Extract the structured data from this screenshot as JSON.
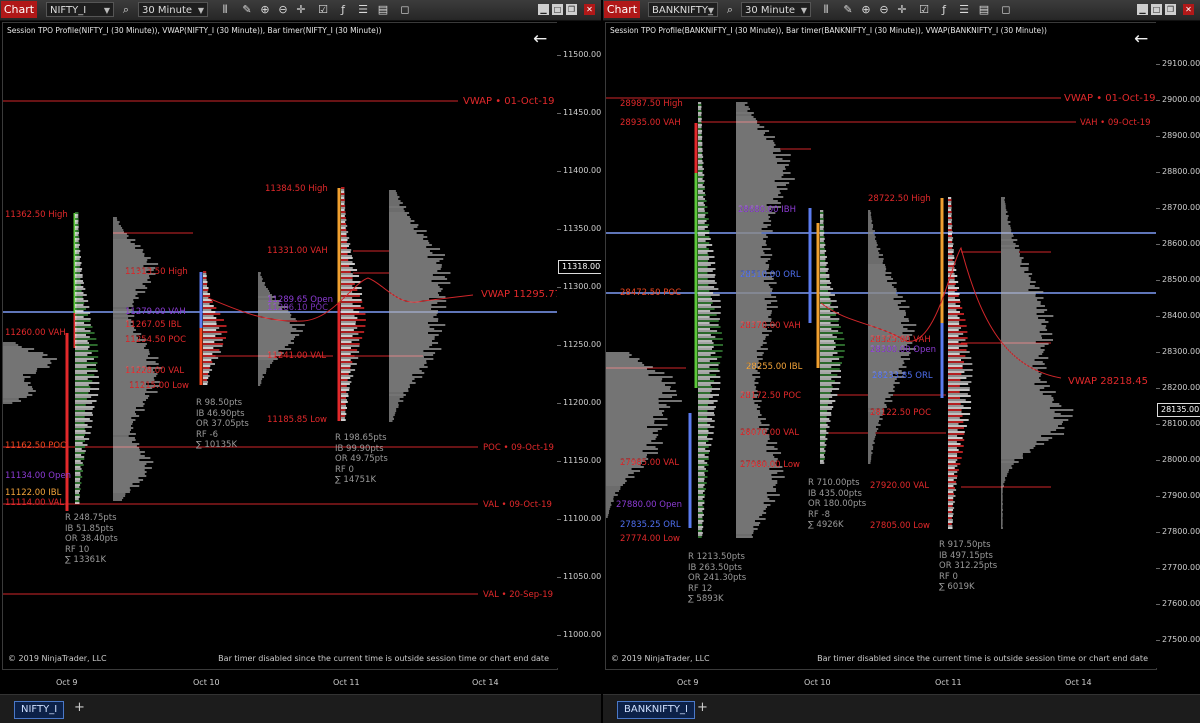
{
  "left": {
    "toolbar": {
      "chart_label": "Chart",
      "instrument": "NIFTY_I",
      "interval": "30 Minute"
    },
    "title": "Session TPO Profile(NIFTY_I (30 Minute)), VWAP(NIFTY_I (30 Minute)), Bar timer(NIFTY_I (30 Minute))",
    "f_label": "F",
    "copyright": "© 2019 NinjaTrader, LLC",
    "bar_timer": "Bar timer disabled since the current time is outside session time or chart end date",
    "y_ticks": [
      "11500.00",
      "11450.00",
      "11400.00",
      "11350.00",
      "11300.00",
      "11250.00",
      "11200.00",
      "11150.00",
      "11100.00",
      "11050.00",
      "11000.00"
    ],
    "current_price": "11318.00",
    "x_ticks": [
      "Oct 9",
      "Oct 10",
      "Oct 11",
      "Oct 14"
    ],
    "tab": "NIFTY_I",
    "labels": {
      "vwap_oct1": "VWAP • 01-Oct-19",
      "vwap_now": "VWAP 11295.77",
      "poc_oct9": "POC • 09-Oct-19",
      "val_oct9": "VAL • 09-Oct-19",
      "val_sep20": "VAL • 20-Sep-19",
      "d1_high": "11362.50 High",
      "d1_vah": "11260.00 VAH",
      "d1_poc": "11162.50 POC",
      "d1_open": "11134.00 Open",
      "d1_ibl": "11122.00 IBL",
      "d1_val": "11114.00 VAL",
      "d2_high": "11313.50 High",
      "d2_vah": "11279.00 VAH",
      "d2_ibl": "11267.05 IBL",
      "d2_poc": "11254.50 POC",
      "d2_val": "11228.00 VAL",
      "d2_low": "11215.00 Low",
      "d3_high": "11384.50 High",
      "d3_vah": "11331.00 VAH",
      "d3_open": "11289.65 Open",
      "d3_poc": "11286.10 POC",
      "d3_val": "11241.00 VAL",
      "d3_low": "11185.85 Low"
    },
    "stats": {
      "d1": [
        "R 248.75pts",
        "IB 51.85pts",
        "OR 38.40pts",
        "RF 10",
        "∑ 13361K"
      ],
      "d2": [
        "R 98.50pts",
        "IB 46.90pts",
        "OR 37.05pts",
        "RF -6",
        "∑ 10135K"
      ],
      "d3": [
        "R 198.65pts",
        "IB 99.90pts",
        "OR 49.75pts",
        "RF 0",
        "∑ 14751K"
      ]
    }
  },
  "right": {
    "toolbar": {
      "chart_label": "Chart",
      "instrument": "BANKNIFTY_",
      "interval": "30 Minute"
    },
    "title": "Session TPO Profile(BANKNIFTY_I (30 Minute)), Bar timer(BANKNIFTY_I (30 Minute)), VWAP(BANKNIFTY_I (30 Minute))",
    "f_label": "F",
    "copyright": "© 2019 NinjaTrader, LLC",
    "bar_timer": "Bar timer disabled since the current time is outside session time or chart end date",
    "y_ticks": [
      "29100.00",
      "29000.00",
      "28900.00",
      "28800.00",
      "28700.00",
      "28600.00",
      "28500.00",
      "28400.00",
      "28300.00",
      "28200.00",
      "28100.00",
      "28000.00",
      "27900.00",
      "27800.00",
      "27700.00",
      "27600.00",
      "27500.00"
    ],
    "current_price": "28135.00",
    "x_ticks": [
      "Oct 9",
      "Oct 10",
      "Oct 11",
      "Oct 14"
    ],
    "tab": "BANKNIFTY_I",
    "labels": {
      "vwap_oct1": "VWAP • 01-Oct-19",
      "vah_oct9": "VAH • 09-Oct-19",
      "vwap_now": "VWAP 28218.45",
      "d1_high": "28987.50 High",
      "d1_vah": "28935.00 VAH",
      "d1_poc": "28472.50 POC",
      "d1_val": "27985.00 VAL",
      "d1_open": "27880.00 Open",
      "d1_orl": "27835.25 ORL",
      "d1_low": "27774.00 Low",
      "d2_ibh": "28680.00 IBH",
      "d2_orl": "28510.00 ORL",
      "d2_vah": "28370.00 VAH",
      "d2_ibl": "28255.00 IBL",
      "d2_poc": "28172.50 POC",
      "d2_val": "28070.00 VAL",
      "d2_low": "27980.00 Low",
      "d3_high": "28722.50 High",
      "d3_vah": "28325.00 VAH",
      "d3_open": "28300.00 Open",
      "d3_orl": "28233.85 ORL",
      "d3_poc": "28122.50 POC",
      "d3_val": "27920.00 VAL",
      "d3_low": "27805.00 Low"
    },
    "stats": {
      "d1": [
        "R 1213.50pts",
        "IB 263.50pts",
        "OR 241.30pts",
        "RF 12",
        "∑ 5893K"
      ],
      "d2": [
        "R 710.00pts",
        "IB 435.00pts",
        "OR 180.00pts",
        "RF -8",
        "∑ 4926K"
      ],
      "d3": [
        "R 917.50pts",
        "IB 497.15pts",
        "OR 312.25pts",
        "RF 0",
        "∑ 6019K"
      ]
    }
  },
  "colors": {
    "accent_red": "#b01818",
    "level_red": "#e2292b",
    "vwap_blue": "#6f8ff0",
    "tab_blue": "#4a78c8"
  }
}
